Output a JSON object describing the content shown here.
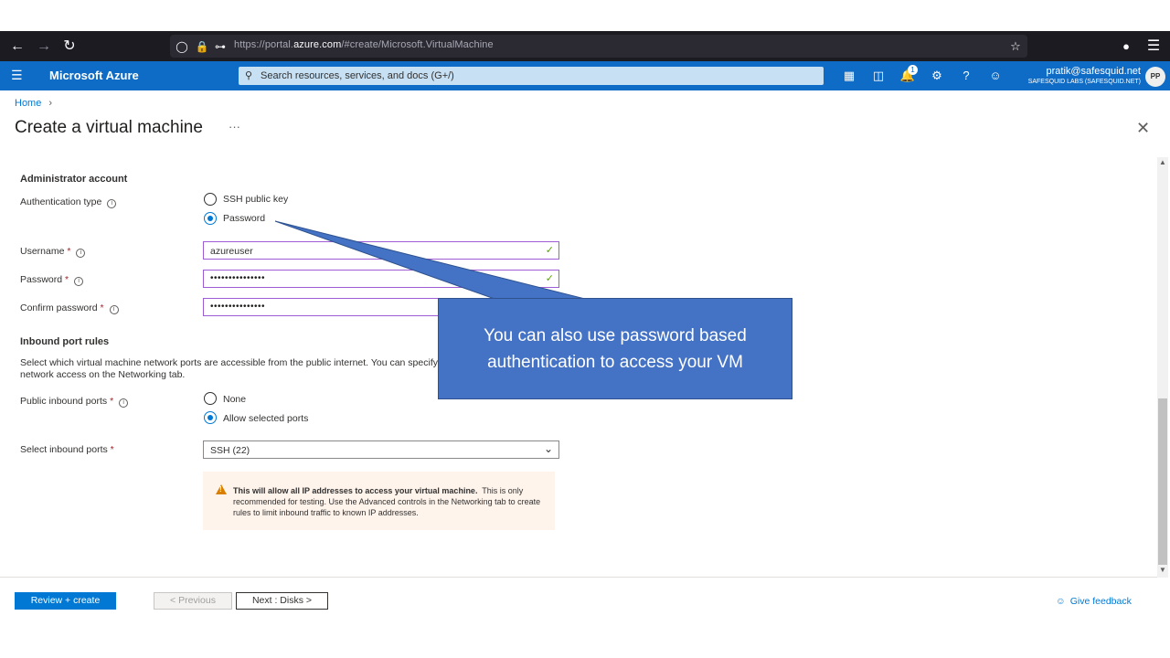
{
  "browser": {
    "url_prefix": "https://portal.",
    "url_domain": "azure.com",
    "url_suffix": "/#create/Microsoft.VirtualMachine"
  },
  "azure": {
    "brand": "Microsoft Azure",
    "search_placeholder": "Search resources, services, and docs (G+/)",
    "notification_count": "1",
    "user_email": "pratik@safesquid.net",
    "user_org": "SAFESQUID LABS (SAFESQUID.NET)",
    "avatar_initials": "PP"
  },
  "page": {
    "breadcrumb_home": "Home",
    "title": "Create a virtual machine",
    "more": "···"
  },
  "admin": {
    "heading": "Administrator account",
    "auth_label": "Authentication type",
    "auth_options": [
      "SSH public key",
      "Password"
    ],
    "auth_selected": "Password",
    "username_label": "Username",
    "username_value": "azureuser",
    "password_label": "Password",
    "password_value": "•••••••••••••••",
    "confirm_label": "Confirm password",
    "confirm_value": "•••••••••••••••",
    "required_mark": "*"
  },
  "inbound": {
    "heading": "Inbound port rules",
    "description": "Select which virtual machine network ports are accessible from the public internet. You can specify",
    "description_2": "network access on the Networking tab.",
    "public_label": "Public inbound ports",
    "public_options": [
      "None",
      "Allow selected ports"
    ],
    "public_selected": "Allow selected ports",
    "select_label": "Select inbound ports",
    "select_value": "SSH (22)",
    "warning_bold": "This will allow all IP addresses to access your virtual machine.",
    "warning_text": "This is only recommended for testing.  Use the Advanced controls in the Networking tab to create rules to limit inbound traffic to known IP addresses."
  },
  "footer": {
    "review_create": "Review + create",
    "previous": "< Previous",
    "next": "Next : Disks >",
    "feedback": "Give feedback"
  },
  "callout": {
    "text": "You can also use password based authentication to access your VM"
  },
  "colors": {
    "azure_blue": "#0f6cc6",
    "primary": "#0078d4",
    "callout": "#4472c4",
    "warning": "#d97f00",
    "valid_check": "#57a300"
  }
}
